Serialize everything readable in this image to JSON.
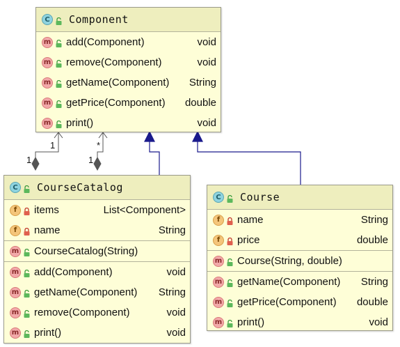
{
  "classes": {
    "component": {
      "kind": "C",
      "name": "Component",
      "methods": [
        {
          "kind": "m",
          "label": "add(Component)",
          "type": "void"
        },
        {
          "kind": "m",
          "label": "remove(Component)",
          "type": "void"
        },
        {
          "kind": "m",
          "label": "getName(Component)",
          "type": "String"
        },
        {
          "kind": "m",
          "label": "getPrice(Component)",
          "type": "double"
        },
        {
          "kind": "m",
          "label": "print()",
          "type": "void"
        }
      ]
    },
    "catalog": {
      "kind": "C",
      "name": "CourseCatalog",
      "fields": [
        {
          "kind": "f",
          "label": "items",
          "type": "List<Component>"
        },
        {
          "kind": "f",
          "label": "name",
          "type": "String"
        }
      ],
      "constructors": [
        {
          "kind": "m",
          "label": "CourseCatalog(String)",
          "type": ""
        }
      ],
      "methods": [
        {
          "kind": "m",
          "label": "add(Component)",
          "type": "void"
        },
        {
          "kind": "m",
          "label": "getName(Component)",
          "type": "String"
        },
        {
          "kind": "m",
          "label": "remove(Component)",
          "type": "void"
        },
        {
          "kind": "m",
          "label": "print()",
          "type": "void"
        }
      ]
    },
    "course": {
      "kind": "C",
      "name": "Course",
      "fields": [
        {
          "kind": "f",
          "label": "name",
          "type": "String"
        },
        {
          "kind": "f",
          "label": "price",
          "type": "double"
        }
      ],
      "constructors": [
        {
          "kind": "m",
          "label": "Course(String, double)",
          "type": ""
        }
      ],
      "methods": [
        {
          "kind": "m",
          "label": "getName(Component)",
          "type": "String"
        },
        {
          "kind": "m",
          "label": "getPrice(Component)",
          "type": "double"
        },
        {
          "kind": "m",
          "label": "print()",
          "type": "void"
        }
      ]
    }
  },
  "relations": {
    "multiplicities": {
      "a_target": "1",
      "a_source": "1",
      "b_target": "*",
      "b_source": "1"
    }
  },
  "colors": {
    "class_fill": "#fefed7",
    "class_header": "#eeeebe",
    "inheritance": "#1a1a8c",
    "aggregation": "#555555"
  },
  "icons": {
    "class": "class-c-icon",
    "method": "method-m-icon",
    "field": "field-f-icon",
    "public": "unlock-icon",
    "private": "lock-icon"
  }
}
